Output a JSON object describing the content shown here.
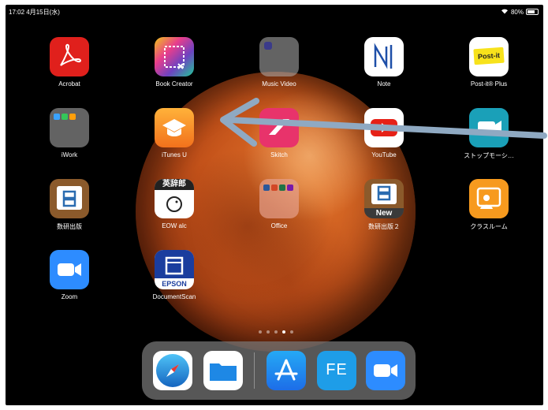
{
  "status": {
    "time": "17:02 4月15日(水)",
    "battery": "80%",
    "battery_level": 0.8
  },
  "apps": [
    {
      "label": "Acrobat",
      "icon": "acrobat-icon"
    },
    {
      "label": "Book Creator",
      "icon": "book-creator-icon"
    },
    {
      "label": "Music Video",
      "icon": "folder-icon"
    },
    {
      "label": "Note",
      "icon": "note-icon"
    },
    {
      "label": "Post-it® Plus",
      "icon": "post-it-icon",
      "icon_text": "Post-it"
    },
    {
      "label": "iWork",
      "icon": "folder-icon"
    },
    {
      "label": "iTunes U",
      "icon": "itunes-u-icon"
    },
    {
      "label": "Skitch",
      "icon": "skitch-icon"
    },
    {
      "label": "YouTube",
      "icon": "youtube-icon"
    },
    {
      "label": "ストップモーシ…",
      "icon": "stop-motion-icon"
    },
    {
      "label": "数研出版",
      "icon": "suken-icon"
    },
    {
      "label": "EOW alc",
      "icon": "eow-icon",
      "icon_text": "英辞郎"
    },
    {
      "label": "Office",
      "icon": "folder-icon"
    },
    {
      "label": "数研出版２",
      "icon": "suken-icon",
      "icon_text": "New"
    },
    {
      "label": "クラスルーム",
      "icon": "classroom-icon"
    },
    {
      "label": "Zoom",
      "icon": "zoom-icon"
    },
    {
      "label": "DocumentScan",
      "icon": "epson-scan-icon",
      "icon_text": "EPSON"
    }
  ],
  "dock": [
    {
      "icon": "safari-icon"
    },
    {
      "icon": "files-icon"
    },
    {
      "icon": "app-store-icon"
    },
    {
      "icon": "fe-icon",
      "icon_text": "FE"
    },
    {
      "icon": "zoom-icon"
    }
  ],
  "page_dots": {
    "count": 5,
    "current": 4
  },
  "colors": {
    "arrow": "#8fa9c2",
    "background": "#000000",
    "planet": "#c4521a"
  }
}
